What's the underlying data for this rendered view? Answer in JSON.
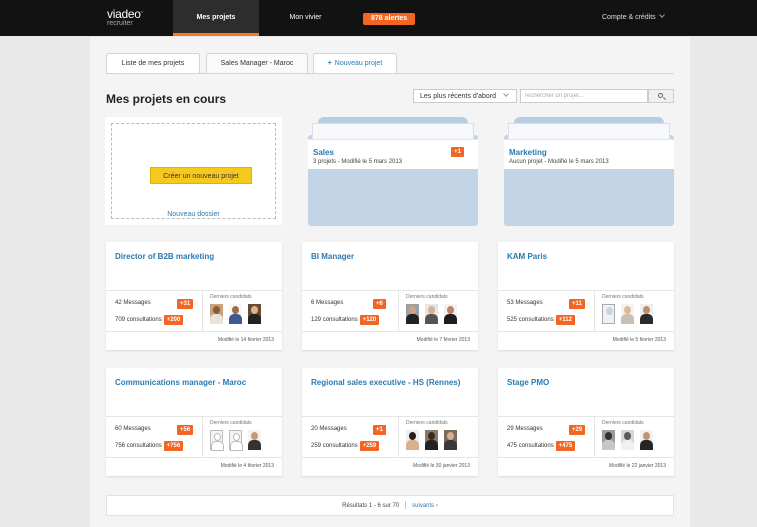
{
  "header": {
    "logo": "viadeo",
    "logo_sub": "recruiter",
    "nav_active": "Mes projets",
    "nav_vivier": "Mon vivier",
    "alerts": "878 alertes",
    "account": "Compte & crédits"
  },
  "tabs": {
    "list": "Liste de mes projets",
    "sales_manager": "Sales Manager - Maroc",
    "new_project": "Nouveau projet"
  },
  "main": {
    "title": "Mes projets en cours",
    "sort_value": "Les plus récents d'abord",
    "search_placeholder": "rechercher un projet..."
  },
  "newbox": {
    "create": "Créer un nouveau projet",
    "new_folder": "Nouveau dossier"
  },
  "folders": [
    {
      "title": "Sales",
      "meta": "3 projets - Modifié le 5 mars 2013",
      "badge": "+1"
    },
    {
      "title": "Marketing",
      "meta": "Aucun projet - Modifié le 5 mars 2013",
      "badge": ""
    }
  ],
  "labels": {
    "messages": "Messages",
    "consultations": "consultations",
    "candidates": "Derniers candidats"
  },
  "projects": [
    {
      "title": "Director of B2B marketing",
      "messages": "42",
      "msg_badge": "+31",
      "consultations": "709",
      "cons_badge": "+200",
      "modified": "Modifié le 14 février 2013"
    },
    {
      "title": "BI Manager",
      "messages": "6",
      "msg_badge": "+6",
      "consultations": "129",
      "cons_badge": "+120",
      "modified": "Modifié le 7 février 2013"
    },
    {
      "title": "KAM Paris",
      "messages": "53",
      "msg_badge": "+11",
      "consultations": "525",
      "cons_badge": "+112",
      "modified": "Modifié le 5 février 2013"
    },
    {
      "title": "Communications manager - Maroc",
      "messages": "60",
      "msg_badge": "+56",
      "consultations": "756",
      "cons_badge": "+756",
      "modified": "Modifié le 4 février 2013"
    },
    {
      "title": "Regional sales executive - HS (Rennes)",
      "messages": "20",
      "msg_badge": "+1",
      "consultations": "259",
      "cons_badge": "+259",
      "modified": "Modifié le 30 janvier 2013"
    },
    {
      "title": "Stage PMO",
      "messages": "29",
      "msg_badge": "+29",
      "consultations": "475",
      "cons_badge": "+475",
      "modified": "Modifié le 22 janvier 2013"
    }
  ],
  "pager": {
    "results": "Résultats 1 - 6 sur 70",
    "next": "suivants ›"
  }
}
